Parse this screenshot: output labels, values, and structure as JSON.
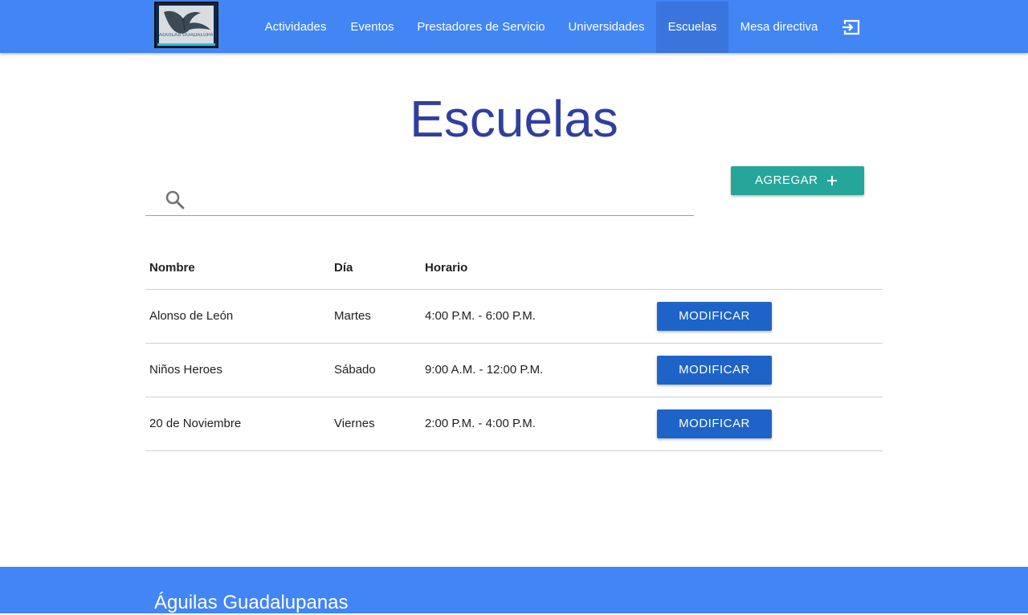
{
  "brand": {
    "logo_text": "ÁGUILAS GUADALUPANAS"
  },
  "nav": {
    "items": [
      {
        "label": "Actividades",
        "active": false
      },
      {
        "label": "Eventos",
        "active": false
      },
      {
        "label": "Prestadores de Servicio",
        "active": false
      },
      {
        "label": "Universidades",
        "active": false
      },
      {
        "label": "Escuelas",
        "active": true
      },
      {
        "label": "Mesa directiva",
        "active": false
      }
    ],
    "exit_icon": "logout-icon"
  },
  "page": {
    "title": "Escuelas"
  },
  "search": {
    "icon": "search-icon",
    "value": "",
    "placeholder": ""
  },
  "actions": {
    "add_label": "AGREGAR",
    "add_icon": "plus-icon"
  },
  "table": {
    "headers": [
      "Nombre",
      "Día",
      "Horario"
    ],
    "rows": [
      {
        "nombre": "Alonso de León",
        "dia": "Martes",
        "horario": "4:00 P.M. - 6:00 P.M.",
        "action": "MODIFICAR"
      },
      {
        "nombre": "Niños Heroes",
        "dia": "Sábado",
        "horario": "9:00 A.M. - 12:00 P.M.",
        "action": "MODIFICAR"
      },
      {
        "nombre": "20 de Noviembre",
        "dia": "Viernes",
        "horario": "2:00 P.M. - 4:00 P.M.",
        "action": "MODIFICAR"
      }
    ]
  },
  "footer": {
    "title": "Águilas Guadalupanas"
  },
  "colors": {
    "primary": "#4285f4",
    "nav_active": "#3a75dd",
    "title": "#303f9f",
    "add_button": "#26a69a",
    "modify_button": "#1e63c8"
  }
}
